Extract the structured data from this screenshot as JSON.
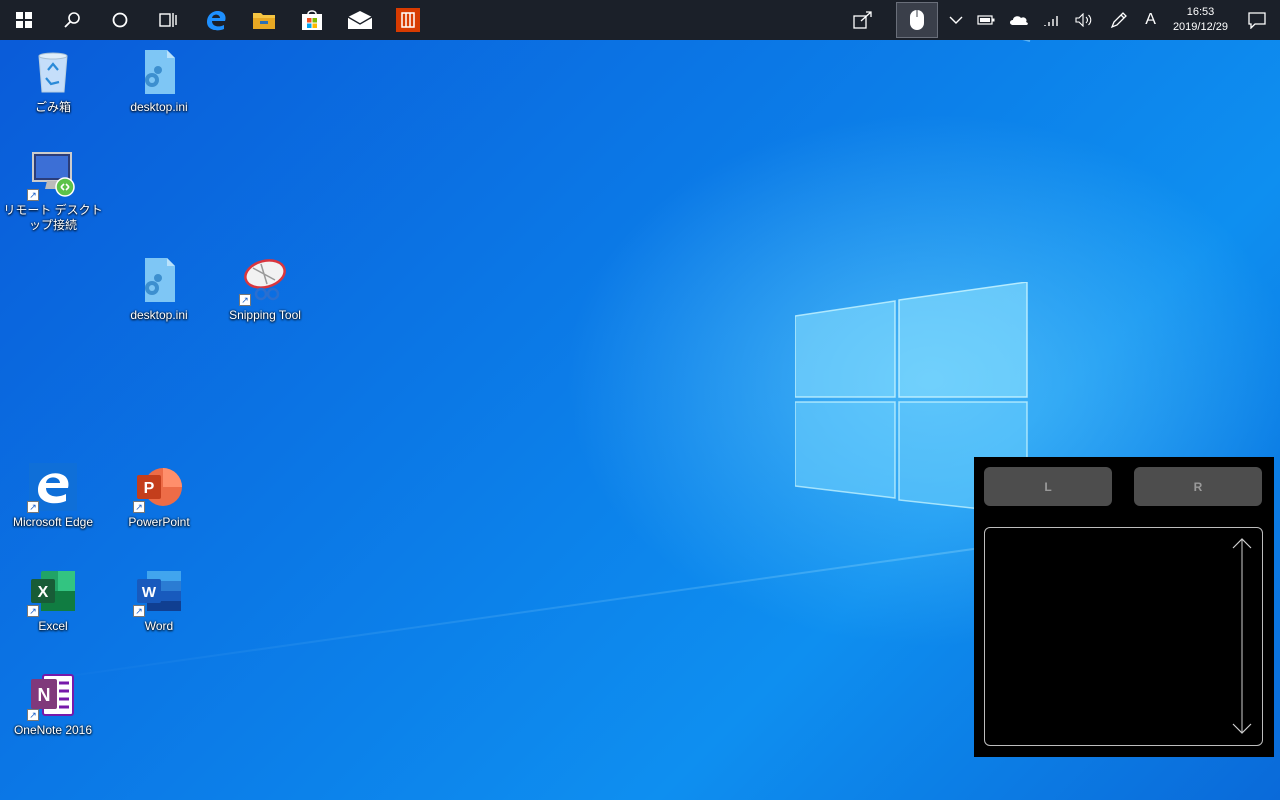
{
  "taskbar": {
    "apps": [
      {
        "name": "start",
        "icon": "windows-icon"
      },
      {
        "name": "search",
        "icon": "search-icon"
      },
      {
        "name": "cortana",
        "icon": "circle-icon"
      },
      {
        "name": "task-view",
        "icon": "task-view-icon"
      },
      {
        "name": "edge",
        "icon": "edge-icon"
      },
      {
        "name": "file-explorer",
        "icon": "folder-icon"
      },
      {
        "name": "store",
        "icon": "store-icon"
      },
      {
        "name": "mail",
        "icon": "mail-icon"
      },
      {
        "name": "office",
        "icon": "office-icon"
      }
    ],
    "tray": {
      "input_indicator": "A",
      "time": "16:53",
      "date": "2019/12/29"
    }
  },
  "desktop": {
    "icons": [
      {
        "id": "recycle-bin",
        "label": "ごみ箱"
      },
      {
        "id": "desktop-ini-1",
        "label": "desktop.ini"
      },
      {
        "id": "remote-desktop",
        "label": "リモート デスクトップ接続"
      },
      {
        "id": "desktop-ini-2",
        "label": "desktop.ini"
      },
      {
        "id": "snipping-tool",
        "label": "Snipping Tool"
      },
      {
        "id": "microsoft-edge",
        "label": "Microsoft Edge"
      },
      {
        "id": "powerpoint",
        "label": "PowerPoint"
      },
      {
        "id": "excel",
        "label": "Excel"
      },
      {
        "id": "word",
        "label": "Word"
      },
      {
        "id": "onenote",
        "label": "OneNote 2016"
      }
    ]
  },
  "touchpad": {
    "left_label": "L",
    "right_label": "R"
  },
  "colors": {
    "taskbar": "#1b2029",
    "desktop_blue": "#0b78e6",
    "touchpad_bg": "#000000",
    "touchpad_button": "#4d4d4d"
  }
}
